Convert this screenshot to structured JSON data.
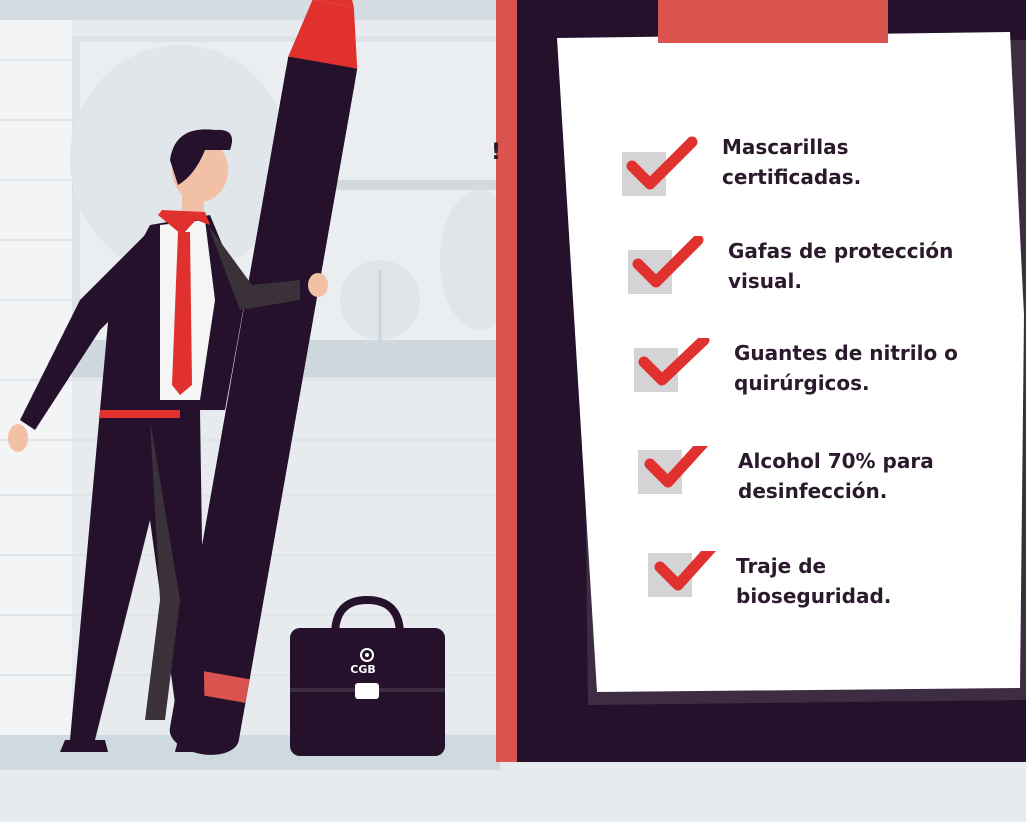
{
  "checklist": {
    "items": [
      {
        "label": "Mascarillas\ncertificadas."
      },
      {
        "label": "Gafas de protección\nvisual."
      },
      {
        "label": "Guantes de nitrilo o\nquirúrgicos."
      },
      {
        "label": "Alcohol 70% para\ndesinfección."
      },
      {
        "label": "Traje de\nbioseguridad."
      }
    ]
  },
  "briefcase": {
    "brand": "CGB"
  },
  "fragment": {
    "exclamation": "!"
  },
  "colors": {
    "dark_purple": "#25112b",
    "accent_red": "#e0312f",
    "coral": "#d9534f",
    "paper": "#ffffff",
    "check_bg": "#d4d4d6",
    "background": "#e8ebee"
  },
  "icons": {
    "check": "checkmark-icon",
    "briefcase": "briefcase-icon",
    "pencil": "giant-pencil"
  }
}
